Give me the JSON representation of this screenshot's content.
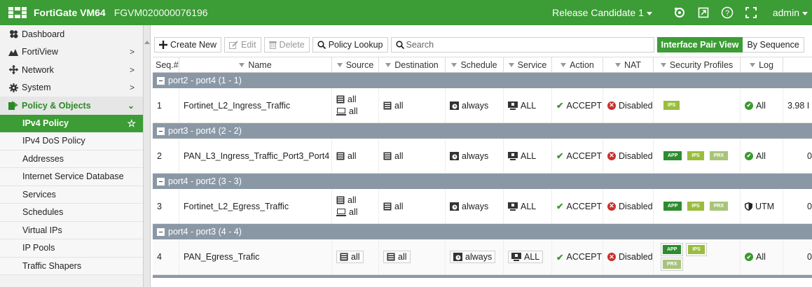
{
  "header": {
    "product": "FortiGate VM64",
    "serial": "FGVM020000076196",
    "release": "Release Candidate 1",
    "user": "admin",
    "accent": "#3c9c35"
  },
  "sidebar": {
    "items": [
      {
        "label": "Dashboard",
        "icon": "dashboard-icon"
      },
      {
        "label": "FortiView",
        "icon": "fortiview-icon",
        "chev": ">"
      },
      {
        "label": "Network",
        "icon": "network-icon",
        "chev": ">"
      },
      {
        "label": "System",
        "icon": "gear-icon",
        "chev": ">"
      },
      {
        "label": "Policy & Objects",
        "icon": "policy-icon",
        "chev": "⌄"
      }
    ],
    "subitems": [
      "IPv4 Policy",
      "IPv4 DoS Policy",
      "Addresses",
      "Internet Service Database",
      "Services",
      "Schedules",
      "Virtual IPs",
      "IP Pools",
      "Traffic Shapers"
    ]
  },
  "toolbar": {
    "create": "Create New",
    "edit": "Edit",
    "delete": "Delete",
    "lookup": "Policy Lookup",
    "search_placeholder": "Search",
    "view_on": "Interface Pair View",
    "view_off": "By Sequence"
  },
  "table": {
    "columns": [
      "Seq.#",
      "Name",
      "Source",
      "Destination",
      "Schedule",
      "Service",
      "Action",
      "NAT",
      "Security Profiles",
      "Log",
      ""
    ],
    "groups": [
      {
        "label": "port2 - port4 (1 - 1)",
        "rows": [
          {
            "seq": "1",
            "name": "Fortinet_L2_Ingress_Traffic",
            "src": [
              "all",
              "all"
            ],
            "dst": "all",
            "schedule": "always",
            "service": "ALL",
            "action": "ACCEPT",
            "nat": "Disabled",
            "profiles": [
              "IPS"
            ],
            "log": "All",
            "extra": "3.98 I"
          }
        ]
      },
      {
        "label": "port3 - port4 (2 - 2)",
        "rows": [
          {
            "seq": "2",
            "name": "PAN_L3_Ingress_Traffic_Port3_Port4",
            "src": [
              "all"
            ],
            "dst": "all",
            "schedule": "always",
            "service": "ALL",
            "action": "ACCEPT",
            "nat": "Disabled",
            "profiles": [
              "APP",
              "IPS",
              "PRX"
            ],
            "log": "All",
            "extra": "0"
          }
        ]
      },
      {
        "label": "port4 - port2 (3 - 3)",
        "rows": [
          {
            "seq": "3",
            "name": "Fortinet_L2_Egress_Traffic",
            "src": [
              "all",
              "all"
            ],
            "dst": "all",
            "schedule": "always",
            "service": "ALL",
            "action": "ACCEPT",
            "nat": "Disabled",
            "profiles": [
              "APP",
              "IPS",
              "PRX"
            ],
            "log": "UTM",
            "extra": "0"
          }
        ]
      },
      {
        "label": "port4 - port3 (4 - 4)",
        "rows": [
          {
            "seq": "4",
            "name": "PAN_Egress_Trafic",
            "src": [
              "all"
            ],
            "dst": "all",
            "schedule": "always",
            "service": "ALL",
            "action": "ACCEPT",
            "nat": "Disabled",
            "profiles": [
              "APP",
              "IPS",
              "PRX"
            ],
            "log": "All",
            "extra": "0"
          }
        ]
      }
    ]
  }
}
